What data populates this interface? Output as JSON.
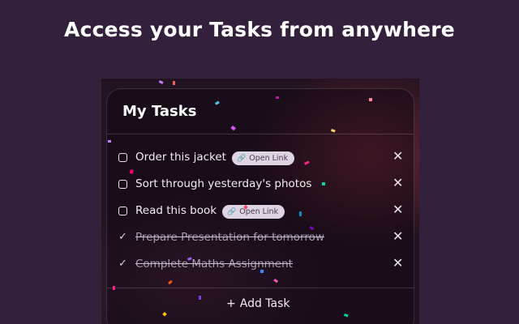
{
  "headline": "Access your Tasks from anywhere",
  "card": {
    "title": "My Tasks",
    "add_task_label": "Add Task",
    "add_icon": "plus-icon"
  },
  "tasks": [
    {
      "label": "Order this jacket",
      "completed": false,
      "link_label": "Open Link"
    },
    {
      "label": "Sort through yesterday's photos",
      "completed": false,
      "link_label": ""
    },
    {
      "label": "Read this book",
      "completed": false,
      "link_label": "Open Link"
    },
    {
      "label": "Prepare Presentation for tomorrow",
      "completed": true,
      "link_label": ""
    },
    {
      "label": "Complete Maths Assignment",
      "completed": true,
      "link_label": ""
    }
  ],
  "icons": {
    "link": "link-icon",
    "delete": "close-icon",
    "check": "check-icon",
    "checkbox": "checkbox-icon"
  },
  "colors": {
    "page_background": "#33213b",
    "card_background": "#21131f",
    "accent_glow": "#82283c",
    "link_pill": "#ddd6e2"
  }
}
